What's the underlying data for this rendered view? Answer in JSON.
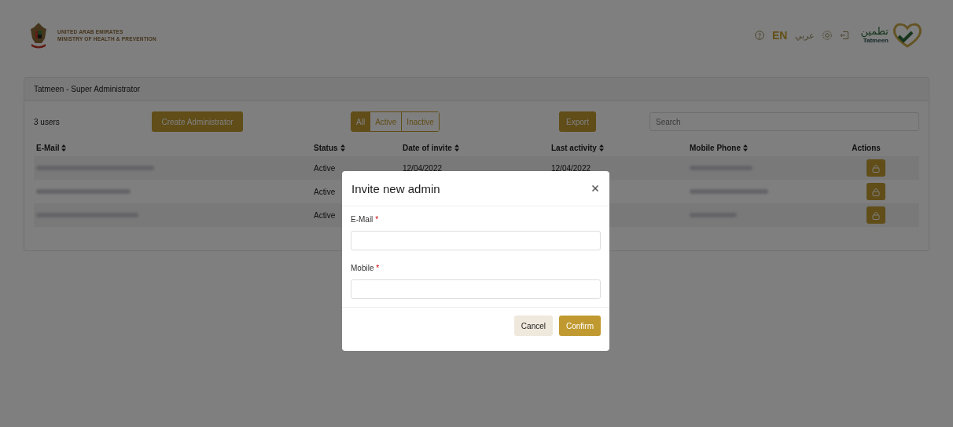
{
  "header": {
    "ministry_lines": [
      "UNITED ARAB EMIRATES",
      "MINISTRY OF HEALTH & PREVENTION"
    ],
    "languages": [
      {
        "label": "EN",
        "selected": true
      },
      {
        "label": "عربي",
        "selected": false
      }
    ],
    "brand": {
      "arabic": "تطمين",
      "latin": "Tatmeen"
    }
  },
  "card": {
    "title": "Tatmeen - Super Administrator",
    "user_count": "3 users",
    "create_button": "Create Administrator",
    "filters": [
      {
        "label": "All",
        "selected": true
      },
      {
        "label": "Active",
        "selected": false
      },
      {
        "label": "Inactive",
        "selected": false
      }
    ],
    "export_button": "Export",
    "search": {
      "placeholder": "Search"
    }
  },
  "table": {
    "columns": [
      {
        "label": "E-Mail",
        "sortable": true
      },
      {
        "label": "Status",
        "sortable": true
      },
      {
        "label": "Date of invite",
        "sortable": true
      },
      {
        "label": "Last activity",
        "sortable": true
      },
      {
        "label": "Mobile Phone",
        "sortable": true
      },
      {
        "label": "Actions",
        "sortable": false
      }
    ],
    "rows": [
      {
        "status": "Active",
        "date_of_invite": "12/04/2022",
        "last_activity": "12/04/2022"
      },
      {
        "status": "Active"
      },
      {
        "status": "Active"
      }
    ]
  },
  "modal": {
    "title": "Invite new admin",
    "fields": [
      {
        "label": "E-Mail",
        "required_mark": "*"
      },
      {
        "label": "Mobile",
        "required_mark": "*"
      }
    ],
    "buttons": [
      {
        "label": "Cancel",
        "kind": "secondary"
      },
      {
        "label": "Confirm",
        "kind": "primary"
      }
    ]
  }
}
